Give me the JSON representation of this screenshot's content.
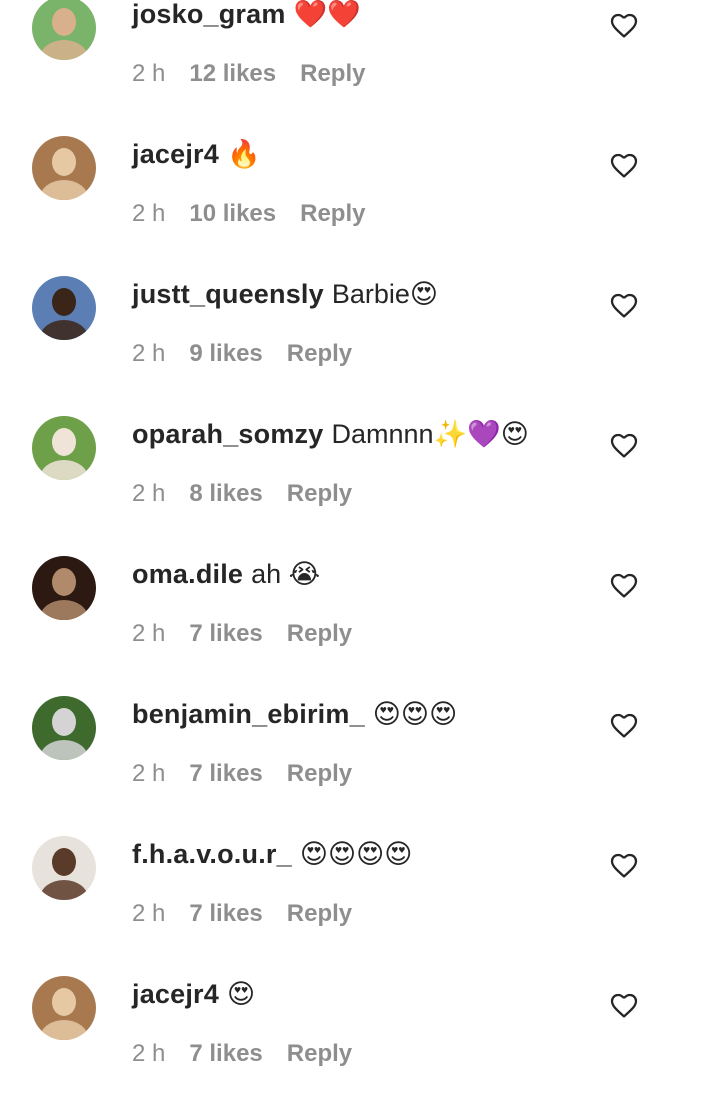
{
  "comments": [
    {
      "username": "josko_gram",
      "text": "❤️❤️",
      "time": "2 h",
      "likes": "12 likes",
      "reply": "Reply",
      "avatar_colors": [
        "#7ab36a",
        "#d9b08c"
      ]
    },
    {
      "username": "jacejr4",
      "text": "🔥",
      "time": "2 h",
      "likes": "10 likes",
      "reply": "Reply",
      "avatar_colors": [
        "#a8794f",
        "#e6c9a3"
      ]
    },
    {
      "username": "justt_queensly",
      "text": "Barbie😍",
      "time": "2 h",
      "likes": "9 likes",
      "reply": "Reply",
      "avatar_colors": [
        "#5b7fb5",
        "#3b2418"
      ]
    },
    {
      "username": "oparah_somzy",
      "text": "Damnnn✨💜😍",
      "time": "2 h",
      "likes": "8 likes",
      "reply": "Reply",
      "avatar_colors": [
        "#6ea04a",
        "#f0e4d8"
      ]
    },
    {
      "username": "oma.dile",
      "text": "ah 😭",
      "time": "2 h",
      "likes": "7 likes",
      "reply": "Reply",
      "avatar_colors": [
        "#2c1a12",
        "#b08a6b"
      ]
    },
    {
      "username": "benjamin_ebirim_",
      "text": "😍😍😍",
      "time": "2 h",
      "likes": "7 likes",
      "reply": "Reply",
      "avatar_colors": [
        "#3f6a2e",
        "#d4d4d4"
      ]
    },
    {
      "username": "f.h.a.v.o.u.r_",
      "text": "😍😍😍😍",
      "time": "2 h",
      "likes": "7 likes",
      "reply": "Reply",
      "avatar_colors": [
        "#e8e2dc",
        "#5a3a28"
      ]
    },
    {
      "username": "jacejr4",
      "text": "😍",
      "time": "2 h",
      "likes": "7 likes",
      "reply": "Reply",
      "avatar_colors": [
        "#a8794f",
        "#e6c9a3"
      ]
    }
  ],
  "icons": {
    "like": "heart-outline-icon"
  },
  "colors": {
    "text_primary": "#262626",
    "text_secondary": "#8e8e8e",
    "background": "#ffffff"
  }
}
